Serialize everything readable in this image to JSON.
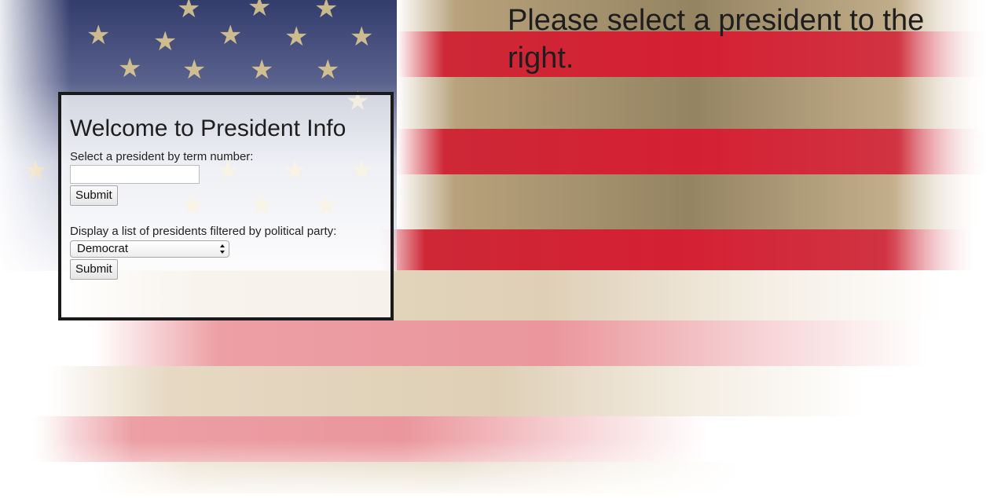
{
  "heading_right": "Please select a president to the right.",
  "panel": {
    "title": "Welcome to President Info",
    "term_label": "Select a president by term number:",
    "term_input_value": "",
    "term_submit_label": "Submit",
    "party_label": "Display a list of presidents filtered by political party:",
    "party_selected": "Democrat",
    "party_submit_label": "Submit"
  },
  "colors": {
    "flag_red": "#c81020",
    "flag_blue": "#283264",
    "panel_border": "#1a1a1a"
  }
}
